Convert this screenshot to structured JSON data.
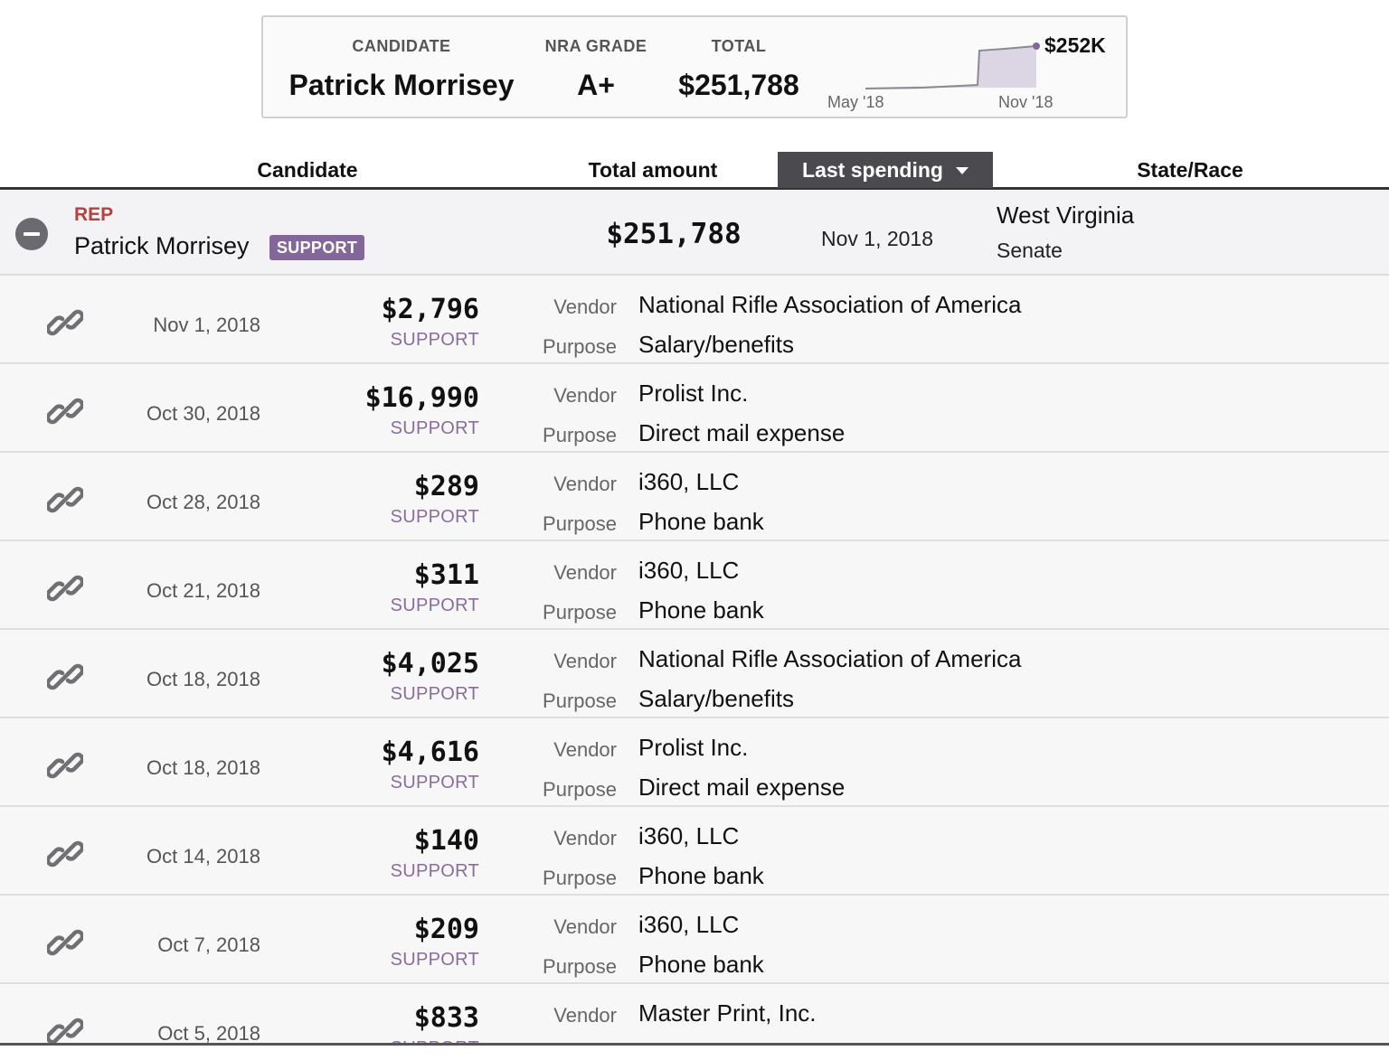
{
  "summary": {
    "candidate_label": "CANDIDATE",
    "candidate_name": "Patrick Morrisey",
    "grade_label": "NRA GRADE",
    "grade": "A+",
    "total_label": "TOTAL",
    "total": "$251,788",
    "spark_peak": "$252K",
    "spark_start": "May '18",
    "spark_end": "Nov '18"
  },
  "table": {
    "headers": {
      "candidate": "Candidate",
      "total": "Total amount",
      "last": "Last spending",
      "state": "State/Race"
    },
    "candidate_row": {
      "party": "REP",
      "name": "Patrick Morrisey",
      "badge": "SUPPORT",
      "total": "$251,788",
      "last": "Nov 1, 2018",
      "state": "West Virginia",
      "race": "Senate"
    },
    "vendor_label": "Vendor",
    "purpose_label": "Purpose",
    "rows": [
      {
        "date": "Nov 1, 2018",
        "amount": "$2,796",
        "support": "SUPPORT",
        "vendor": "National Rifle Association of America",
        "purpose": "Salary/benefits"
      },
      {
        "date": "Oct 30, 2018",
        "amount": "$16,990",
        "support": "SUPPORT",
        "vendor": "Prolist Inc.",
        "purpose": "Direct mail expense"
      },
      {
        "date": "Oct 28, 2018",
        "amount": "$289",
        "support": "SUPPORT",
        "vendor": "i360, LLC",
        "purpose": "Phone bank"
      },
      {
        "date": "Oct 21, 2018",
        "amount": "$311",
        "support": "SUPPORT",
        "vendor": "i360, LLC",
        "purpose": "Phone bank"
      },
      {
        "date": "Oct 18, 2018",
        "amount": "$4,025",
        "support": "SUPPORT",
        "vendor": "National Rifle Association of America",
        "purpose": "Salary/benefits"
      },
      {
        "date": "Oct 18, 2018",
        "amount": "$4,616",
        "support": "SUPPORT",
        "vendor": "Prolist Inc.",
        "purpose": "Direct mail expense"
      },
      {
        "date": "Oct 14, 2018",
        "amount": "$140",
        "support": "SUPPORT",
        "vendor": "i360, LLC",
        "purpose": "Phone bank"
      },
      {
        "date": "Oct 7, 2018",
        "amount": "$209",
        "support": "SUPPORT",
        "vendor": "i360, LLC",
        "purpose": "Phone bank"
      },
      {
        "date": "Oct 5, 2018",
        "amount": "$833",
        "support": "SUPPORT",
        "vendor": "Master Print, Inc.",
        "purpose": ""
      }
    ]
  },
  "colors": {
    "accent": "#84679a",
    "party_rep": "#b5413d",
    "header_active": "#4a4a4f"
  },
  "icons": [
    "link-icon",
    "collapse-icon",
    "caret-down-icon"
  ]
}
